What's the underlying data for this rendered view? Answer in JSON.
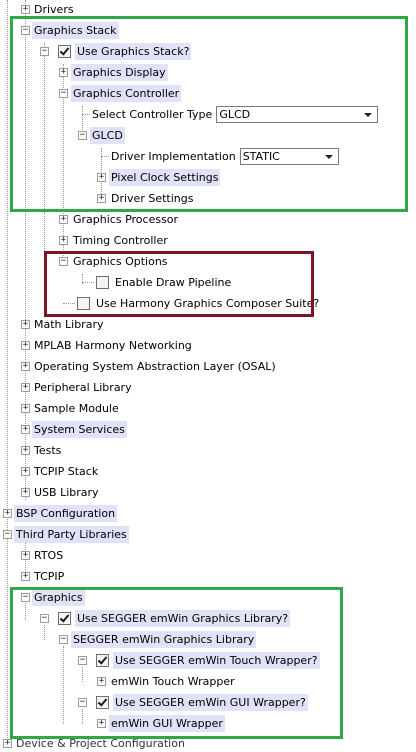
{
  "tree": {
    "drivers": "Drivers",
    "graphics_stack": "Graphics Stack",
    "use_graphics_stack": "Use Graphics Stack?",
    "graphics_display": "Graphics Display",
    "graphics_controller": "Graphics Controller",
    "select_controller_type": "Select Controller Type",
    "controller_type_value": "GLCD",
    "glcd": "GLCD",
    "driver_implementation": "Driver Implementation",
    "driver_implementation_value": "STATIC",
    "pixel_clock_settings": "Pixel Clock Settings",
    "driver_settings": "Driver Settings",
    "graphics_processor": "Graphics Processor",
    "timing_controller": "Timing Controller",
    "graphics_options": "Graphics Options",
    "enable_draw_pipeline": "Enable Draw Pipeline",
    "use_harmony_composer": "Use Harmony Graphics Composer Suite?",
    "math_library": "Math Library",
    "mplab_networking": "MPLAB Harmony Networking",
    "osal": "Operating System Abstraction Layer (OSAL)",
    "peripheral_library": "Peripheral Library",
    "sample_module": "Sample Module",
    "system_services": "System Services",
    "tests": "Tests",
    "tcpip_stack": "TCPIP Stack",
    "usb_library": "USB Library",
    "bsp_configuration": "BSP Configuration",
    "third_party_libraries": "Third Party Libraries",
    "rtos": "RTOS",
    "tcpip": "TCPIP",
    "graphics": "Graphics",
    "use_segger_emwin": "Use SEGGER emWin Graphics Library?",
    "segger_emwin_library": "SEGGER emWin Graphics Library",
    "use_touch_wrapper": "Use SEGGER emWin Touch Wrapper?",
    "emwin_touch_wrapper": "emWin Touch Wrapper",
    "use_gui_wrapper": "Use SEGGER emWin GUI Wrapper?",
    "emwin_gui_wrapper": "emWin GUI Wrapper",
    "cutoff_row": "Device & Project Configuration"
  },
  "checkboxes": {
    "use_graphics_stack": true,
    "enable_draw_pipeline": false,
    "use_harmony_composer": false,
    "use_segger_emwin": true,
    "use_touch_wrapper": true,
    "use_gui_wrapper": true
  },
  "colors": {
    "highlight_box_green": "#2fa84a",
    "highlight_box_maroon": "#7e1226",
    "label_highlight": "#e1e1f7"
  }
}
